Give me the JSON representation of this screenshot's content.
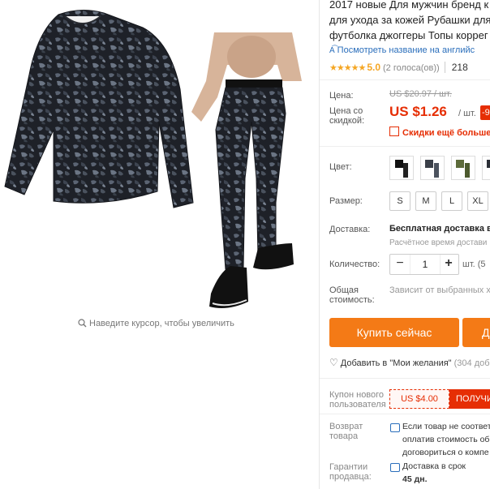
{
  "gallery": {
    "zoom_hint": "Наведите курсор, чтобы увеличить"
  },
  "product": {
    "title_lines": [
      "2017 новые Для мужчин бренд к",
      "для ухода за кожей Рубашки для",
      "футболка джоггеры Топы коррег"
    ],
    "translate_link": "Посмотреть название на английс",
    "rating_stars": "★★★★★",
    "rating_value": "5.0",
    "rating_votes": "(2 голоса(ов))",
    "orders": "218"
  },
  "price": {
    "label": "Цена:",
    "old": "US $20.97 / шт.",
    "discount_label": "Цена со скидкой:",
    "new": "US $1.26",
    "unit": "/ шт.",
    "badge": "-9",
    "bulk_text": "Скидки ещё больше в"
  },
  "options": {
    "color_label": "Цвет:",
    "size_label": "Размер:",
    "sizes": [
      "S",
      "M",
      "L",
      "XL",
      "X"
    ]
  },
  "shipping": {
    "label": "Доставка:",
    "main": "Бесплатная доставка в",
    "sub": "Расчётное время достави"
  },
  "quantity": {
    "label": "Количество:",
    "minus": "−",
    "value": "1",
    "plus": "+",
    "unit": "шт. (5"
  },
  "total": {
    "label": "Общая стоимость:",
    "value": "Зависит от выбранных хар"
  },
  "actions": {
    "buy": "Купить сейчас",
    "cart": "Д",
    "wishlist": "Добавить в \"Мои желания\"",
    "wishlist_count": "(304 доб"
  },
  "coupon": {
    "label": "Купон нового пользователя",
    "amount": "US $4.00",
    "get": "ПОЛУЧИ"
  },
  "returns": {
    "label": "Возврат товара",
    "lines": [
      "Если товар не соответ",
      "оплатив стоимость об",
      "договориться о компе"
    ]
  },
  "guarantee": {
    "label": "Гарантии продавца:",
    "lines": [
      "Доставка в срок",
      "45 дн."
    ]
  },
  "colors": {
    "price_red": "#e62e04",
    "button_orange": "#f47a16",
    "link_blue": "#2a6ebb",
    "star_gold": "#f5a623"
  }
}
